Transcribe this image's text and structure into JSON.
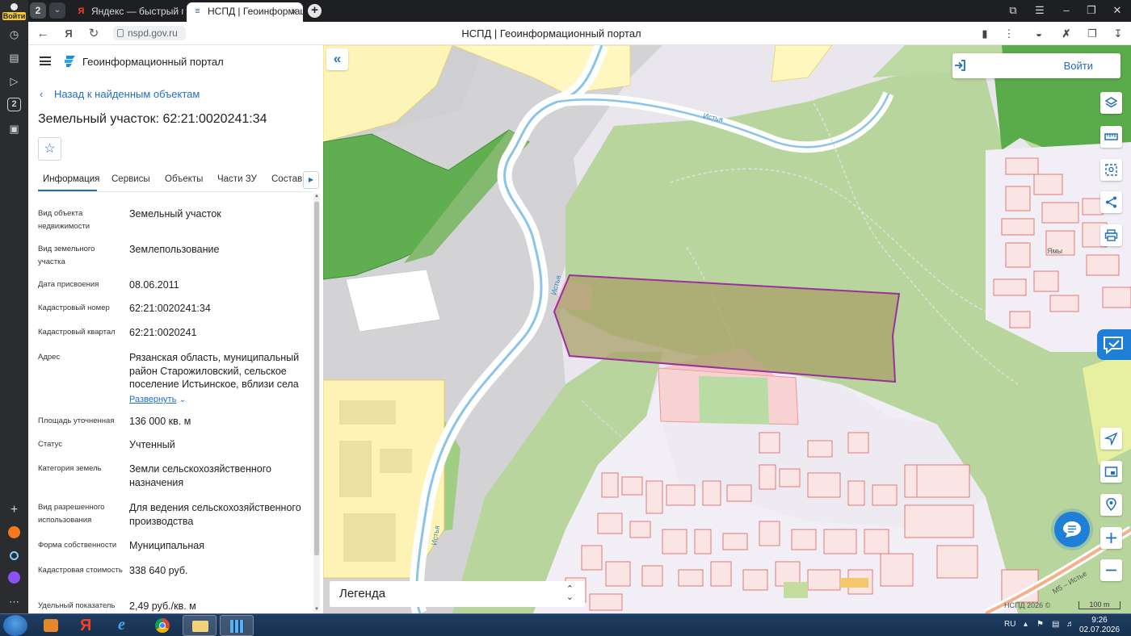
{
  "browser": {
    "login_label": "Войти",
    "tab_count": "2",
    "tabs": [
      {
        "label": "Яндекс — быстрый поиск",
        "favicon": "Я"
      },
      {
        "label": "НСПД | Геоинформаци",
        "favicon": "e"
      }
    ],
    "url": "nspd.gov.ru",
    "page_title": "НСПД | Геоинформационный портал"
  },
  "panel": {
    "portal_title": "Геоинформационный портал",
    "back_label": "Назад к найденным объектам",
    "object_title": "Земельный участок: 62:21:0020241:34",
    "tabs": [
      "Информация",
      "Сервисы",
      "Объекты",
      "Части ЗУ",
      "Состав"
    ],
    "properties": [
      {
        "key": "Вид объекта недвижимости",
        "value": "Земельный участок"
      },
      {
        "key": "Вид земельного участка",
        "value": "Землепользование"
      },
      {
        "key": "Дата присвоения",
        "value": "08.06.2011"
      },
      {
        "key": "Кадастровый номер",
        "value": "62:21:0020241:34"
      },
      {
        "key": "Кадастровый квартал",
        "value": "62:21:0020241"
      },
      {
        "key": "Адрес",
        "value": "Рязанская область, муниципальный район Старожиловский, сельское поселение Истьинское, вблизи села"
      },
      {
        "key": "Площадь уточненная",
        "value": "136 000 кв. м"
      },
      {
        "key": "Статус",
        "value": "Учтенный"
      },
      {
        "key": "Категория земель",
        "value": "Земли сельскохозяйственного назначения"
      },
      {
        "key": "Вид разрешенного использования",
        "value": "Для ведения сельскохозяйственного производства"
      },
      {
        "key": "Форма собственности",
        "value": "Муниципальная"
      },
      {
        "key": "Кадастровая стоимость",
        "value": "338 640 руб."
      },
      {
        "key": "Удельный показатель",
        "value": "2,49 руб./кв. м"
      }
    ],
    "expand_label": "Развернуть"
  },
  "map": {
    "login_label": "Войти",
    "legend_label": "Легенда",
    "labels": {
      "river1": "Истья",
      "river2": "Истья",
      "river3": "Истья",
      "village": "Ямы",
      "road": "M5 – Истье"
    },
    "copyright": "НСПД 2026 ©",
    "scale_label": "100 m"
  },
  "taskbar": {
    "lang": "RU",
    "time": "9:26",
    "date": "02.07.2026"
  }
}
